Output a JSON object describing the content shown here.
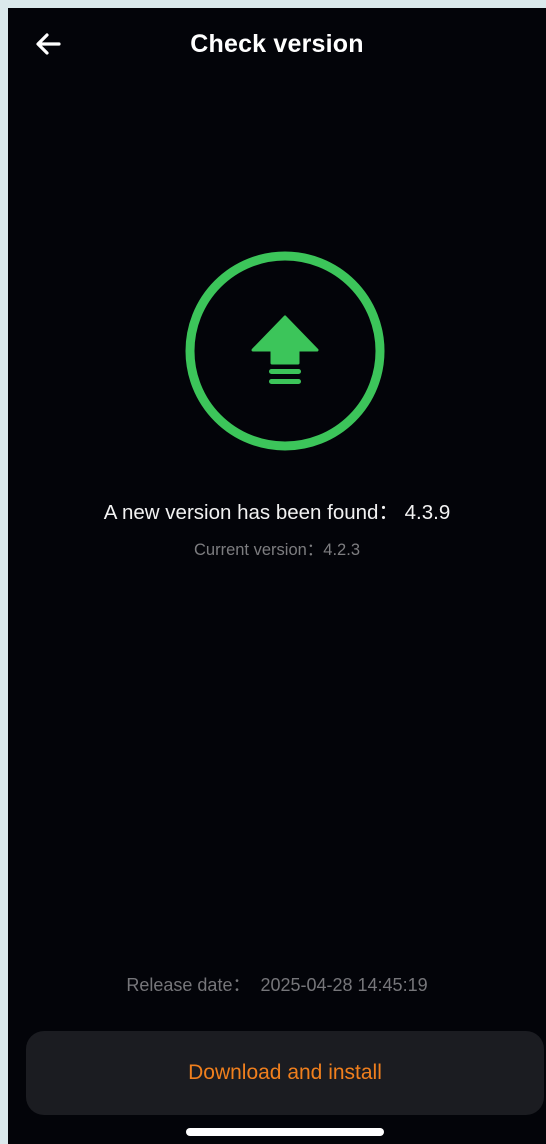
{
  "header": {
    "title": "Check version",
    "back_icon": "arrow-left-icon"
  },
  "update": {
    "icon": "upload-arrow-icon",
    "accent_color": "#3cc55a",
    "found_label": "A new version has been found：",
    "new_version": "4.3.9",
    "current_label": "Current version：",
    "current_version": "4.2.3"
  },
  "release": {
    "label": "Release date：",
    "date": "2025-04-28 14:45:19"
  },
  "actions": {
    "download_label": "Download and install",
    "download_color": "#f07f1d"
  }
}
